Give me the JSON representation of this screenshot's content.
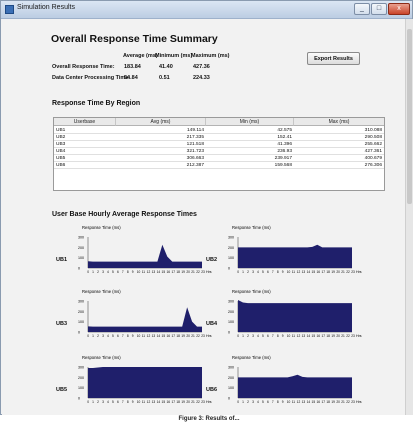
{
  "window": {
    "title": "Simulation Results",
    "min": "_",
    "max": "□",
    "close": "x"
  },
  "summary": {
    "title": "Overall Response Time Summary",
    "headers": [
      "Average (ms)",
      "Minimum (ms)",
      "Maximum (ms)"
    ],
    "rows": [
      {
        "label": "Overall Response Time:",
        "avg": "183.84",
        "min": "41.40",
        "max": "427.36"
      },
      {
        "label": "Data Center Processing Time:",
        "avg": "54.84",
        "min": "0.51",
        "max": "224.33"
      }
    ],
    "export_label": "Export Results"
  },
  "region": {
    "title": "Response Time By Region",
    "columns": [
      "Userbase",
      "Avg (ms)",
      "Min (ms)",
      "Max (ms)"
    ],
    "rows": [
      [
        "UB1",
        "149.114",
        "42.575",
        "310.088"
      ],
      [
        "UB2",
        "217.335",
        "152.41",
        "290.508"
      ],
      [
        "UB3",
        "121.518",
        "41.396",
        "255.662"
      ],
      [
        "UB4",
        "321.723",
        "236.93",
        "427.361"
      ],
      [
        "UB5",
        "306.663",
        "239.917",
        "400.679"
      ],
      [
        "UB6",
        "212.387",
        "159.568",
        "276.306"
      ]
    ]
  },
  "hourly": {
    "title": "User Base Hourly Average Response Times",
    "ylabel": "Response Time (ms)",
    "xunit": "Hrs",
    "hours": [
      "0",
      "1",
      "2",
      "3",
      "4",
      "5",
      "6",
      "7",
      "8",
      "9",
      "10",
      "11",
      "12",
      "13",
      "14",
      "15",
      "16",
      "17",
      "18",
      "19",
      "20",
      "21",
      "22",
      "23"
    ],
    "yticks_a": [
      "300",
      "200",
      "100",
      "0"
    ],
    "yticks_b": [
      "300",
      "200",
      "100",
      "0"
    ]
  },
  "chart_data": [
    {
      "type": "area",
      "name": "UB1",
      "ylim": [
        0,
        300
      ],
      "x": [
        "0",
        "1",
        "2",
        "3",
        "4",
        "5",
        "6",
        "7",
        "8",
        "9",
        "10",
        "11",
        "12",
        "13",
        "14",
        "15",
        "16",
        "17",
        "18",
        "19",
        "20",
        "21",
        "22",
        "23"
      ],
      "values": [
        65,
        62,
        62,
        62,
        62,
        62,
        62,
        62,
        62,
        62,
        62,
        62,
        62,
        62,
        62,
        225,
        110,
        62,
        62,
        62,
        62,
        62,
        62,
        62
      ]
    },
    {
      "type": "area",
      "name": "UB2",
      "ylim": [
        0,
        300
      ],
      "x": [
        "0",
        "1",
        "2",
        "3",
        "4",
        "5",
        "6",
        "7",
        "8",
        "9",
        "10",
        "11",
        "12",
        "13",
        "14",
        "15",
        "16",
        "17",
        "18",
        "19",
        "20",
        "21",
        "22",
        "23"
      ],
      "values": [
        200,
        200,
        200,
        200,
        200,
        200,
        200,
        200,
        200,
        200,
        200,
        200,
        200,
        200,
        200,
        205,
        225,
        200,
        200,
        200,
        200,
        200,
        200,
        200
      ]
    },
    {
      "type": "area",
      "name": "UB3",
      "ylim": [
        0,
        300
      ],
      "x": [
        "0",
        "1",
        "2",
        "3",
        "4",
        "5",
        "6",
        "7",
        "8",
        "9",
        "10",
        "11",
        "12",
        "13",
        "14",
        "15",
        "16",
        "17",
        "18",
        "19",
        "20",
        "21",
        "22",
        "23"
      ],
      "values": [
        55,
        52,
        52,
        52,
        52,
        52,
        52,
        52,
        52,
        52,
        52,
        52,
        52,
        52,
        52,
        52,
        52,
        52,
        52,
        52,
        240,
        100,
        52,
        52
      ]
    },
    {
      "type": "area",
      "name": "UB4",
      "ylim": [
        0,
        300
      ],
      "x": [
        "0",
        "1",
        "2",
        "3",
        "4",
        "5",
        "6",
        "7",
        "8",
        "9",
        "10",
        "11",
        "12",
        "13",
        "14",
        "15",
        "16",
        "17",
        "18",
        "19",
        "20",
        "21",
        "22",
        "23"
      ],
      "values": [
        310,
        285,
        280,
        280,
        280,
        280,
        280,
        280,
        280,
        280,
        280,
        280,
        280,
        280,
        280,
        280,
        280,
        280,
        280,
        280,
        280,
        280,
        280,
        280
      ]
    },
    {
      "type": "area",
      "name": "UB5",
      "ylim": [
        0,
        300
      ],
      "x": [
        "0",
        "1",
        "2",
        "3",
        "4",
        "5",
        "6",
        "7",
        "8",
        "9",
        "10",
        "11",
        "12",
        "13",
        "14",
        "15",
        "16",
        "17",
        "18",
        "19",
        "20",
        "21",
        "22",
        "23"
      ],
      "values": [
        290,
        290,
        295,
        300,
        300,
        300,
        300,
        300,
        300,
        300,
        300,
        300,
        300,
        300,
        300,
        300,
        300,
        300,
        300,
        300,
        300,
        300,
        300,
        300
      ]
    },
    {
      "type": "area",
      "name": "UB6",
      "ylim": [
        0,
        300
      ],
      "x": [
        "0",
        "1",
        "2",
        "3",
        "4",
        "5",
        "6",
        "7",
        "8",
        "9",
        "10",
        "11",
        "12",
        "13",
        "14",
        "15",
        "16",
        "17",
        "18",
        "19",
        "20",
        "21",
        "22",
        "23"
      ],
      "values": [
        200,
        200,
        200,
        200,
        200,
        200,
        200,
        200,
        200,
        200,
        200,
        210,
        225,
        205,
        200,
        200,
        200,
        200,
        200,
        200,
        200,
        200,
        200,
        200
      ]
    }
  ],
  "caption": "Figure 3: Results of...",
  "colors": {
    "area": "#1f1f6b",
    "titlebar": "#bccde3"
  }
}
